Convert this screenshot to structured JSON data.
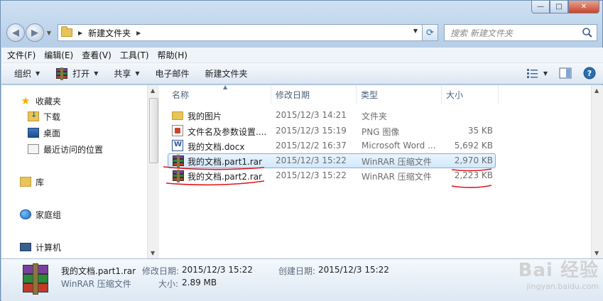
{
  "window": {
    "caption_buttons": [
      "—",
      "□",
      "✕"
    ]
  },
  "address_bar": {
    "path": "新建文件夹",
    "search_placeholder": "搜索 新建文件夹"
  },
  "menu": [
    "文件(F)",
    "编辑(E)",
    "查看(V)",
    "工具(T)",
    "帮助(H)"
  ],
  "toolbar": {
    "organize": "组织",
    "open": "打开",
    "share": "共享",
    "email": "电子邮件",
    "new_folder": "新建文件夹"
  },
  "nav_pane": {
    "favorites": "收藏夹",
    "downloads": "下载",
    "desktop": "桌面",
    "recent": "最近访问的位置",
    "libraries": "库",
    "homegroup": "家庭组",
    "computer": "计算机"
  },
  "columns": {
    "name": "名称",
    "date": "修改日期",
    "type": "类型",
    "size": "大小"
  },
  "files": [
    {
      "name": "我的图片",
      "date": "2015/12/3 14:21",
      "type": "文件夹",
      "size": "",
      "icon": "folder-icon"
    },
    {
      "name": "文件名及参数设置....",
      "date": "2015/12/3 15:19",
      "type": "PNG 图像",
      "size": "35 KB",
      "icon": "png-icon"
    },
    {
      "name": "我的文档.docx",
      "date": "2015/12/2 16:37",
      "type": "Microsoft Word ...",
      "size": "5,692 KB",
      "icon": "word-icon"
    },
    {
      "name": "我的文档.part1.rar",
      "date": "2015/12/3 15:22",
      "type": "WinRAR 压缩文件",
      "size": "2,970 KB",
      "icon": "rar-icon"
    },
    {
      "name": "我的文档.part2.rar",
      "date": "2015/12/3 15:22",
      "type": "WinRAR 压缩文件",
      "size": "2,223 KB",
      "icon": "rar-icon"
    }
  ],
  "selected_index": 3,
  "details": {
    "filename": "我的文档.part1.rar",
    "filetype": "WinRAR 压缩文件",
    "modified_label": "修改日期:",
    "modified_value": "2015/12/3 15:22",
    "created_label": "创建日期:",
    "created_value": "2015/12/3 15:22",
    "size_label": "大小:",
    "size_value": "2.89 MB"
  },
  "watermark": {
    "main": "Bai 经验",
    "sub": "jingyan.baidu.com"
  },
  "colors": {
    "annotation": "#e0151b",
    "selection_border": "#84acdd"
  }
}
